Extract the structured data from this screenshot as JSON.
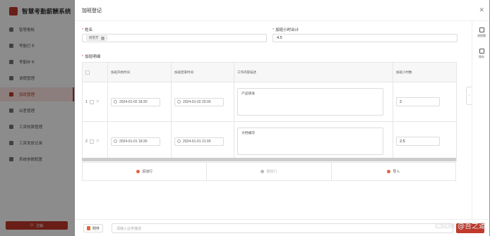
{
  "app": {
    "title": "智慧考勤薪酬系统",
    "sidebar": [
      {
        "label": "智慧看板",
        "active": false
      },
      {
        "label": "考勤打卡",
        "active": false
      },
      {
        "label": "考勤补卡",
        "active": false
      },
      {
        "label": "请假管理",
        "active": false
      },
      {
        "label": "加班管理",
        "active": true
      },
      {
        "label": "出差管理",
        "active": false
      },
      {
        "label": "工资核算管理",
        "active": false
      },
      {
        "label": "工资发放记录",
        "active": false
      },
      {
        "label": "系统参数配置",
        "active": false
      }
    ],
    "logout_label": "注销"
  },
  "drawer": {
    "title": "加班登记",
    "name_label": "姓名",
    "name_tag": "杨雪芳",
    "hours_label": "加班小时合计",
    "hours_value": "4.5",
    "detail_label": "加班明细",
    "columns": [
      "",
      "加班开始时间",
      "加班结束时间",
      "工作内容描述",
      "加班小时数"
    ],
    "rows": [
      {
        "no": "1",
        "start": "2024-01-02 18:30",
        "end": "2024-01-02 20:30",
        "desc": "产品研发",
        "hours": "2"
      },
      {
        "no": "2",
        "start": "2024-01-01 18:30",
        "end": "2024-01-01 21:00",
        "desc": "文档编写",
        "hours": "2.5"
      }
    ],
    "actions": {
      "add": "添加行",
      "delete": "删除行",
      "import": "导入"
    },
    "rail": {
      "flow": "流程图",
      "save": "保存"
    },
    "attach_label": "附件",
    "remark_placeholder": "请输入业务描述"
  },
  "watermark": "CSDN @吾之道",
  "colors": {
    "accent": "#c0392b",
    "orange": "#e0653f"
  }
}
